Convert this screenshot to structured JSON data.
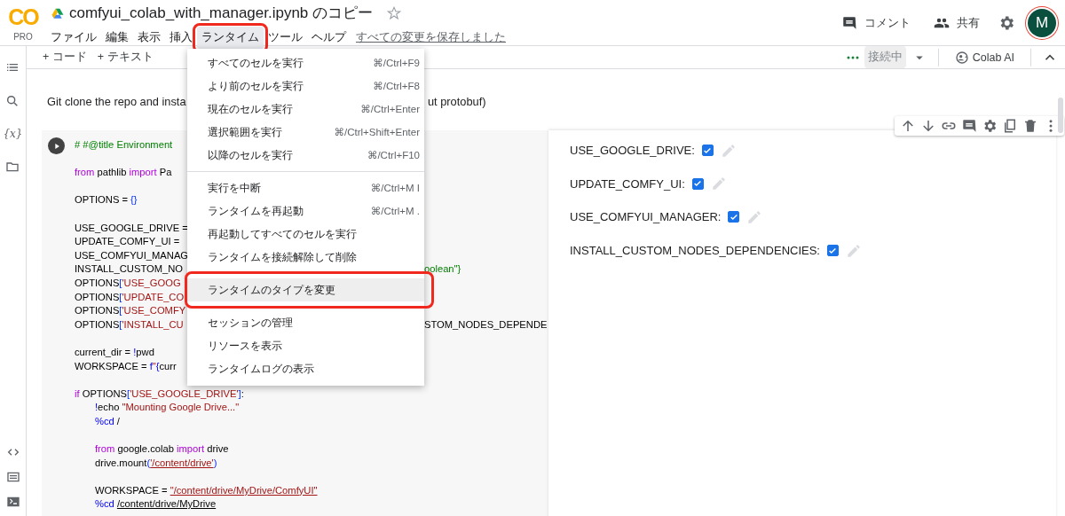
{
  "header": {
    "logo": {
      "mark": "CO",
      "tier": "PRO"
    },
    "title": "comfyui_colab_with_manager.ipynb のコピー",
    "starred": false,
    "menus": [
      {
        "label": "ファイル",
        "open": false,
        "annotated": false
      },
      {
        "label": "編集",
        "open": false,
        "annotated": false
      },
      {
        "label": "表示",
        "open": false,
        "annotated": false
      },
      {
        "label": "挿入",
        "open": false,
        "annotated": false
      },
      {
        "label": "ランタイム",
        "open": true,
        "annotated": true
      },
      {
        "label": "ツール",
        "open": false,
        "annotated": false
      },
      {
        "label": "ヘルプ",
        "open": false,
        "annotated": false
      }
    ],
    "save_status": "すべての変更を保存しました",
    "actions": [
      {
        "kind": "comment",
        "label": "コメント"
      },
      {
        "kind": "share",
        "label": "共有"
      },
      {
        "kind": "settings"
      }
    ],
    "avatar": {
      "initial": "M"
    }
  },
  "toolbar": {
    "add_buttons": [
      "+ コード",
      "+ テキスト"
    ],
    "runtime_status": "接続中",
    "ai_button": "Colab AI"
  },
  "sidebar": {
    "top": [
      {
        "kind": "toc"
      },
      {
        "kind": "search"
      },
      {
        "kind": "variables",
        "text": "{x}"
      },
      {
        "kind": "files"
      }
    ],
    "bottom": [
      {
        "kind": "code"
      },
      {
        "kind": "palette"
      },
      {
        "kind": "terminal"
      }
    ]
  },
  "markdown": {
    "text": "Git clone the repo and insta",
    "tail": "ut protobuf)"
  },
  "cell": {
    "toolbar": [
      {
        "kind": "up"
      },
      {
        "kind": "down"
      },
      {
        "kind": "link"
      },
      {
        "kind": "comment"
      },
      {
        "kind": "settings"
      },
      {
        "kind": "mirror"
      },
      {
        "kind": "delete"
      },
      {
        "kind": "more"
      }
    ],
    "code": [
      {
        "kind": "code",
        "parts": [
          {
            "kind": "comment",
            "text": "# #@title Environment"
          }
        ]
      },
      {
        "kind": "blank"
      },
      {
        "kind": "code",
        "parts": [
          {
            "kind": "keyword",
            "text": "from"
          },
          {
            "kind": "plain",
            "text": " pathlib "
          },
          {
            "kind": "keyword",
            "text": "import"
          },
          {
            "kind": "plain",
            "text": " Pa"
          }
        ]
      },
      {
        "kind": "blank"
      },
      {
        "kind": "code",
        "parts": [
          {
            "kind": "plain",
            "text": "OPTIONS = "
          },
          {
            "kind": "bracket",
            "text": "{}"
          }
        ]
      },
      {
        "kind": "blank"
      },
      {
        "kind": "code",
        "parts": [
          {
            "kind": "plain",
            "text": "USE_GOOGLE_DRIVE ="
          }
        ]
      },
      {
        "kind": "code",
        "parts": [
          {
            "kind": "plain",
            "text": "UPDATE_COMFY_UI ="
          }
        ]
      },
      {
        "kind": "code",
        "parts": [
          {
            "kind": "plain",
            "text": "USE_COMFYUI_MANAG"
          }
        ]
      },
      {
        "kind": "code",
        "parts": [
          {
            "kind": "plain",
            "text": "INSTALL_CUSTOM_NO"
          }
        ],
        "tail": [
          {
            "kind": "comment",
            "text": "oolean\"}"
          }
        ]
      },
      {
        "kind": "code",
        "parts": [
          {
            "kind": "plain",
            "text": "OPTIONS"
          },
          {
            "kind": "bracket",
            "text": "["
          },
          {
            "kind": "string",
            "text": "'USE_GOOG"
          }
        ]
      },
      {
        "kind": "code",
        "parts": [
          {
            "kind": "plain",
            "text": "OPTIONS"
          },
          {
            "kind": "bracket",
            "text": "["
          },
          {
            "kind": "string",
            "text": "'UPDATE_CO"
          }
        ]
      },
      {
        "kind": "code",
        "parts": [
          {
            "kind": "plain",
            "text": "OPTIONS"
          },
          {
            "kind": "bracket",
            "text": "["
          },
          {
            "kind": "string",
            "text": "'USE_COMFY"
          }
        ]
      },
      {
        "kind": "code",
        "parts": [
          {
            "kind": "plain",
            "text": "OPTIONS"
          },
          {
            "kind": "bracket",
            "text": "["
          },
          {
            "kind": "string",
            "text": "'INSTALL_CU"
          }
        ],
        "tail": [
          {
            "kind": "plain",
            "text": "STOM_NODES_DEPENDE"
          }
        ]
      },
      {
        "kind": "blank"
      },
      {
        "kind": "code",
        "parts": [
          {
            "kind": "plain",
            "text": "current_dir = "
          },
          {
            "kind": "magic",
            "text": "!"
          },
          {
            "kind": "plain",
            "text": "pwd"
          }
        ]
      },
      {
        "kind": "code",
        "parts": [
          {
            "kind": "plain",
            "text": "WORKSPACE = "
          },
          {
            "kind": "magic",
            "text": "f"
          },
          {
            "kind": "string",
            "text": "\""
          },
          {
            "kind": "magic",
            "text": "{"
          },
          {
            "kind": "plain",
            "text": "curr"
          }
        ]
      },
      {
        "kind": "blank"
      },
      {
        "kind": "code",
        "parts": [
          {
            "kind": "keyword",
            "text": "if"
          },
          {
            "kind": "plain",
            "text": " OPTIONS"
          },
          {
            "kind": "bracket",
            "text": "["
          },
          {
            "kind": "string",
            "text": "'USE_GOOGLE_DRIVE'"
          },
          {
            "kind": "bracket",
            "text": "]"
          },
          {
            "kind": "plain",
            "text": ":"
          }
        ],
        "children": [
          {
            "kind": "code",
            "parts": [
              {
                "kind": "magic",
                "text": "!"
              },
              {
                "kind": "plain",
                "text": "echo "
              },
              {
                "kind": "string",
                "text": "\"Mounting Google Drive...\""
              }
            ]
          },
          {
            "kind": "code",
            "parts": [
              {
                "kind": "magic",
                "text": "%cd"
              },
              {
                "kind": "plain",
                "text": " /"
              }
            ]
          },
          {
            "kind": "blank"
          },
          {
            "kind": "code",
            "parts": [
              {
                "kind": "keyword",
                "text": "from"
              },
              {
                "kind": "plain",
                "text": " google.colab "
              },
              {
                "kind": "keyword",
                "text": "import"
              },
              {
                "kind": "plain",
                "text": " drive"
              }
            ]
          },
          {
            "kind": "code",
            "parts": [
              {
                "kind": "plain",
                "text": "drive.mount"
              },
              {
                "kind": "bracket",
                "text": "("
              },
              {
                "kind": "string",
                "text": "'/content/drive'",
                "link": true
              },
              {
                "kind": "bracket",
                "text": ")"
              }
            ]
          },
          {
            "kind": "blank"
          },
          {
            "kind": "code",
            "parts": [
              {
                "kind": "plain",
                "text": "WORKSPACE = "
              },
              {
                "kind": "string",
                "text": "\"/content/drive/MyDrive/ComfyUI\"",
                "link": true
              }
            ]
          },
          {
            "kind": "code",
            "parts": [
              {
                "kind": "magic",
                "text": "%cd "
              },
              {
                "kind": "plain",
                "text": "/content/drive/MyDrive",
                "link": true
              }
            ]
          }
        ]
      }
    ],
    "form": [
      {
        "label": "USE_GOOGLE_DRIVE:",
        "checked": true
      },
      {
        "label": "UPDATE_COMFY_UI:",
        "checked": true
      },
      {
        "label": "USE_COMFYUI_MANAGER:",
        "checked": true
      },
      {
        "label": "INSTALL_CUSTOM_NODES_DEPENDENCIES:",
        "checked": true
      }
    ]
  },
  "menu": {
    "groups": [
      [
        {
          "label": "すべてのセルを実行",
          "shortcut": "⌘/Ctrl+F9",
          "selected": false,
          "annotated": false
        },
        {
          "label": "より前のセルを実行",
          "shortcut": "⌘/Ctrl+F8",
          "selected": false,
          "annotated": false
        },
        {
          "label": "現在のセルを実行",
          "shortcut": "⌘/Ctrl+Enter",
          "selected": false,
          "annotated": false
        },
        {
          "label": "選択範囲を実行",
          "shortcut": "⌘/Ctrl+Shift+Enter",
          "selected": false,
          "annotated": false
        },
        {
          "label": "以降のセルを実行",
          "shortcut": "⌘/Ctrl+F10",
          "selected": false,
          "annotated": false
        }
      ],
      [
        {
          "label": "実行を中断",
          "shortcut": "⌘/Ctrl+M I",
          "selected": false,
          "annotated": false
        },
        {
          "label": "ランタイムを再起動",
          "shortcut": "⌘/Ctrl+M .",
          "selected": false,
          "annotated": false
        },
        {
          "label": "再起動してすべてのセルを実行",
          "selected": false,
          "annotated": false
        },
        {
          "label": "ランタイムを接続解除して削除",
          "selected": false,
          "annotated": false
        }
      ],
      [
        {
          "label": "ランタイムのタイプを変更",
          "selected": true,
          "annotated": true
        }
      ],
      [
        {
          "label": "セッションの管理",
          "selected": false,
          "annotated": false
        },
        {
          "label": "リソースを表示",
          "selected": false,
          "annotated": false
        },
        {
          "label": "ランタイムログの表示",
          "selected": false,
          "annotated": false
        }
      ]
    ]
  }
}
